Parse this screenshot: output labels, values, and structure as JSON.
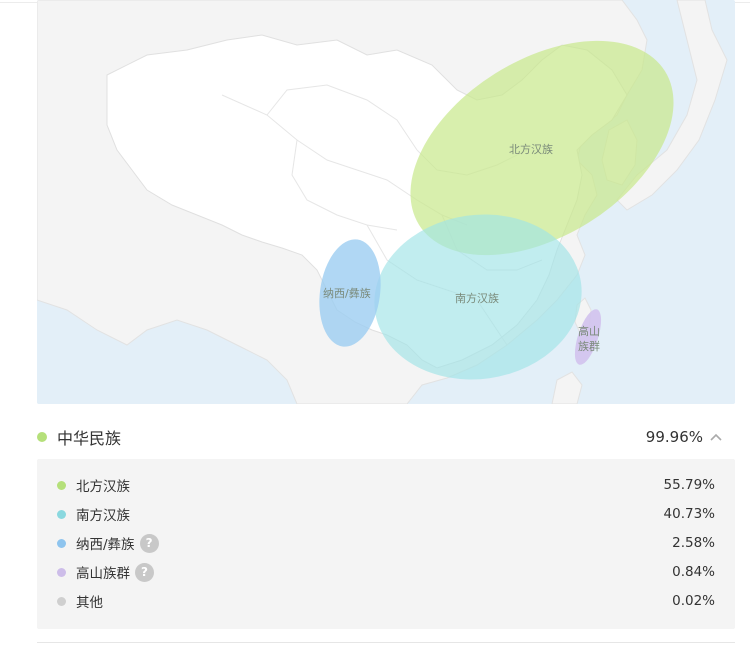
{
  "map": {
    "region_labels": {
      "north_han": "北方汉族",
      "south_han": "南方汉族",
      "naxi_yi": "纳西/彝族",
      "gaoshan_line1": "高山",
      "gaoshan_line2": "族群"
    }
  },
  "group": {
    "name": "中华民族",
    "percent": "99.96%",
    "dot_color": "#b5e07a",
    "expanded": true
  },
  "rows": [
    {
      "label": "北方汉族",
      "percent": "55.79%",
      "color": "#b5e07a",
      "has_help": false
    },
    {
      "label": "南方汉族",
      "percent": "40.73%",
      "color": "#8ad8df",
      "has_help": false
    },
    {
      "label": "纳西/彝族",
      "percent": "2.58%",
      "color": "#8ec4ee",
      "has_help": true
    },
    {
      "label": "高山族群",
      "percent": "0.84%",
      "color": "#cdbde9",
      "has_help": true
    },
    {
      "label": "其他",
      "percent": "0.02%",
      "color": "#cfcfcf",
      "has_help": false
    }
  ],
  "help_glyph": "?",
  "icons": {
    "group_toggle": "chevron-up-icon",
    "help": "question-mark-icon"
  }
}
